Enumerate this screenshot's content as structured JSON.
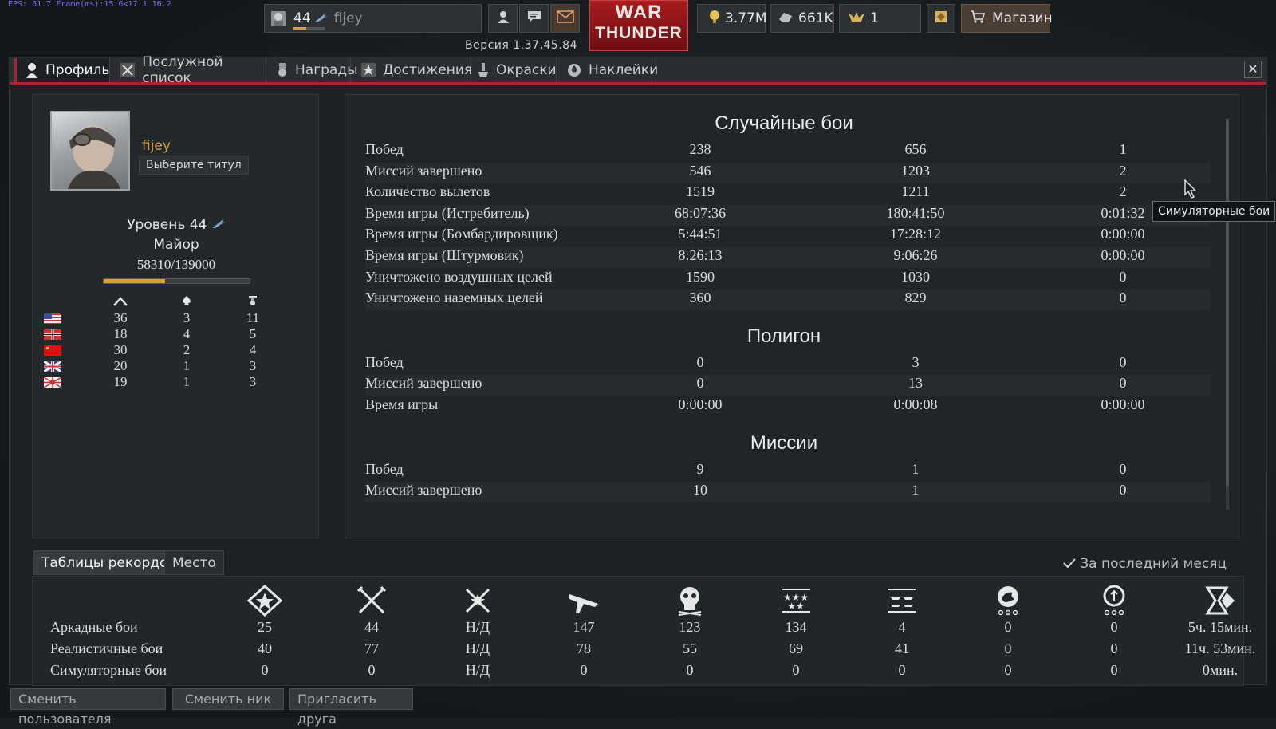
{
  "fps_text": "FPS: 61.7 Frame(ms):15.6<17.1 16.2",
  "topbar": {
    "level": "44",
    "username": "fijey",
    "logo_line1": "WAR",
    "logo_line2": "THUNDER",
    "version": "Версия 1.37.45.84",
    "silver_lions": "3.77M",
    "research_points": "661K",
    "golden_eagles": "1",
    "shop_label": "Магазин"
  },
  "tabs": [
    {
      "label": "Профиль",
      "icon": "pilot-icon"
    },
    {
      "label": "Послужной список",
      "icon": "crossed-swords-icon"
    },
    {
      "label": "Награды",
      "icon": "medal-icon"
    },
    {
      "label": "Достижения",
      "icon": "star-icon"
    },
    {
      "label": "Окраски",
      "icon": "paint-icon"
    },
    {
      "label": "Наклейки",
      "icon": "decal-icon"
    }
  ],
  "profile": {
    "name": "fijey",
    "title_button": "Выберите титул",
    "level_text": "Уровень 44",
    "rank": "Майор",
    "xp_text": "58310/139000",
    "xp_fraction": 0.42,
    "country_rows": [
      {
        "flag": "usa-flag",
        "a": "36",
        "b": "3",
        "c": "11"
      },
      {
        "flag": "germany-flag",
        "a": "18",
        "b": "4",
        "c": "5"
      },
      {
        "flag": "ussr-flag",
        "a": "30",
        "b": "2",
        "c": "4"
      },
      {
        "flag": "britain-flag",
        "a": "20",
        "b": "1",
        "c": "3"
      },
      {
        "flag": "japan-flag",
        "a": "19",
        "b": "1",
        "c": "3"
      }
    ]
  },
  "stats": {
    "random_battles": {
      "title": "Случайные бои",
      "rows": [
        {
          "label": "Побед",
          "arcade": "238",
          "realistic": "656",
          "simulator": "1"
        },
        {
          "label": "Миссий завершено",
          "arcade": "546",
          "realistic": "1203",
          "simulator": "2"
        },
        {
          "label": "Количество вылетов",
          "arcade": "1519",
          "realistic": "1211",
          "simulator": "2"
        },
        {
          "label": "Время игры (Истребитель)",
          "arcade": "68:07:36",
          "realistic": "180:41:50",
          "simulator": "0:01:32"
        },
        {
          "label": "Время игры (Бомбардировщик)",
          "arcade": "5:44:51",
          "realistic": "17:28:12",
          "simulator": "0:00:00"
        },
        {
          "label": "Время игры (Штурмовик)",
          "arcade": "8:26:13",
          "realistic": "9:06:26",
          "simulator": "0:00:00"
        },
        {
          "label": "Уничтожено воздушных целей",
          "arcade": "1590",
          "realistic": "1030",
          "simulator": "0"
        },
        {
          "label": "Уничтожено наземных целей",
          "arcade": "360",
          "realistic": "829",
          "simulator": "0"
        }
      ]
    },
    "polygon": {
      "title": "Полигон",
      "rows": [
        {
          "label": "Побед",
          "arcade": "0",
          "realistic": "3",
          "simulator": "0"
        },
        {
          "label": "Миссий завершено",
          "arcade": "0",
          "realistic": "13",
          "simulator": "0"
        },
        {
          "label": "Время игры",
          "arcade": "0:00:00",
          "realistic": "0:00:08",
          "simulator": "0:00:00"
        }
      ]
    },
    "missions": {
      "title": "Миссии",
      "rows": [
        {
          "label": "Побед",
          "arcade": "9",
          "realistic": "1",
          "simulator": "0"
        },
        {
          "label": "Миссий завершено",
          "arcade": "10",
          "realistic": "1",
          "simulator": "0"
        }
      ]
    },
    "tooltip": "Симуляторные бои"
  },
  "leaderboard": {
    "tabs": [
      "Таблицы рекордов",
      "Место"
    ],
    "period": "За последний месяц",
    "icons": [
      "victories-icon",
      "missions-icon",
      "battles-icon",
      "air-kills-icon",
      "deaths-icon",
      "ground-kills-icon",
      "naval-kills-icon",
      "lion-icon",
      "balloon-icon",
      "time-icon"
    ],
    "rows": [
      {
        "label": "Аркадные бои",
        "values": [
          "25",
          "44",
          "Н/Д",
          "147",
          "123",
          "134",
          "4",
          "0",
          "0",
          "5ч. 15мин."
        ]
      },
      {
        "label": "Реалистичные бои",
        "values": [
          "40",
          "77",
          "Н/Д",
          "78",
          "55",
          "69",
          "41",
          "0",
          "0",
          "11ч. 53мин."
        ]
      },
      {
        "label": "Симуляторные бои",
        "values": [
          "0",
          "0",
          "Н/Д",
          "0",
          "0",
          "0",
          "0",
          "0",
          "0",
          "0мин."
        ]
      }
    ]
  },
  "bottom_buttons": [
    "Сменить пользователя",
    "Сменить ник",
    "Пригласить друга"
  ],
  "colors": {
    "accent_red": "#a7262b",
    "name_gold": "#d8a04a",
    "xp_gold": "#d1a23a"
  }
}
